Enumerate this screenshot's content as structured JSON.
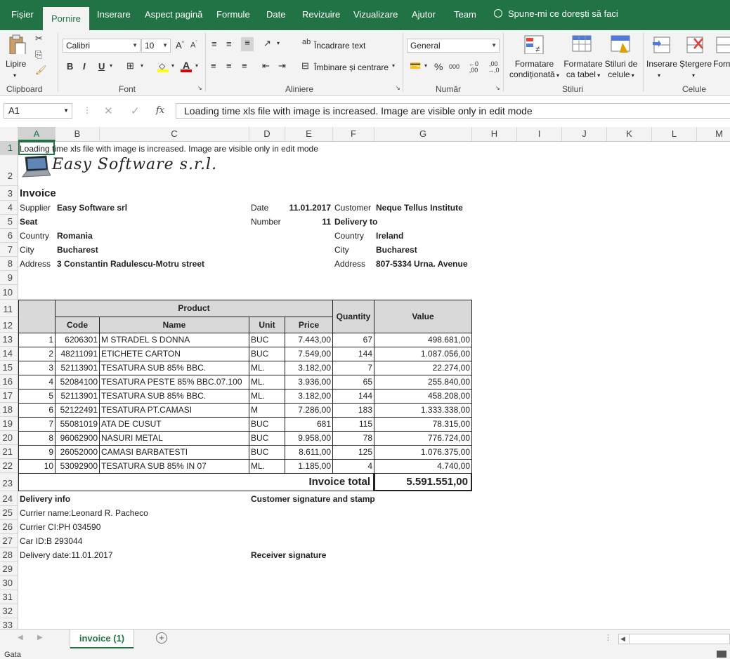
{
  "ribbon_tabs": [
    "Fișier",
    "Pornire",
    "Inserare",
    "Aspect pagină",
    "Formule",
    "Date",
    "Revizuire",
    "Vizualizare",
    "Ajutor",
    "Team"
  ],
  "tell_me": "Spune-mi ce dorești să faci",
  "clipboard": {
    "paste": "Lipire",
    "label": "Clipboard"
  },
  "font": {
    "name": "Calibri",
    "size": "10",
    "label": "Font",
    "bold": "B",
    "italic": "I",
    "underline": "U"
  },
  "alignment": {
    "wrap": "Încadrare text",
    "merge": "Îmbinare și centrare",
    "label": "Aliniere"
  },
  "number": {
    "format": "General",
    "label": "Număr",
    "percent": "%",
    "thousands": "000"
  },
  "styles": {
    "conditional": [
      "Formatare",
      "condiționată"
    ],
    "table": [
      "Formatare",
      "ca tabel"
    ],
    "cell": [
      "Stiluri de",
      "celule"
    ],
    "label": "Stiluri"
  },
  "cells": {
    "insert": "Inserare",
    "delete": "Ștergere",
    "format": "Form",
    "label": "Celule"
  },
  "formula_bar": {
    "name_box": "A1",
    "fx": "fx",
    "content": "Loading time xls file with image is increased. Image are visible only in edit mode"
  },
  "columns": [
    "A",
    "B",
    "C",
    "D",
    "E",
    "F",
    "G",
    "H",
    "I",
    "J",
    "K",
    "L",
    "M"
  ],
  "rows": [
    "1",
    "2",
    "3",
    "4",
    "5",
    "6",
    "7",
    "8",
    "9",
    "10",
    "11",
    "12",
    "13",
    "14",
    "15",
    "16",
    "17",
    "18",
    "19",
    "20",
    "21",
    "22",
    "23",
    "24",
    "25",
    "26",
    "27",
    "28",
    "29",
    "30",
    "31",
    "32",
    "33"
  ],
  "sheet": {
    "a1": "Loading time xls file with image is increased. Image are visible only in edit mode",
    "logo_text": "Easy Software s.r.l.",
    "title": "Invoice",
    "supplier_label": "Supplier",
    "supplier": "Easy Software srl",
    "seat": "Seat",
    "country_label": "Country",
    "country": "Romania",
    "city_label": "City",
    "city": "Bucharest",
    "address_label": "Address",
    "address": "3 Constantin Radulescu-Motru street",
    "date_label": "Date",
    "date": "11.01.2017",
    "number_label": "Number",
    "number": "11",
    "customer_label": "Customer",
    "customer": "Neque Tellus Institute",
    "delivery_to": "Delivery to",
    "cust_country_label": "Country",
    "cust_country": "Ireland",
    "cust_city_label": "City",
    "cust_city": "Bucharest",
    "cust_address_label": "Address",
    "cust_address": "807-5334 Urna. Avenue",
    "delivery_info": "Delivery info",
    "customer_signature": "Customer signature and stamp",
    "currier_name": "Currier name:Leonard R. Pacheco",
    "currier_ci": "Currier CI:PH 034590",
    "car_id": "Car ID:B 293044",
    "delivery_date": "Delivery date:11.01.2017",
    "receiver_signature": "Receiver signature"
  },
  "table": {
    "headers": {
      "product": "Product",
      "code": "Code",
      "name": "Name",
      "unit": "Unit",
      "price": "Price",
      "quantity": "Quantity",
      "value": "Value"
    },
    "rows": [
      {
        "no": "1",
        "code": "6206301",
        "name": "M STRADEL S DONNA",
        "unit": "BUC",
        "price": "7.443,00",
        "qty": "67",
        "value": "498.681,00"
      },
      {
        "no": "2",
        "code": "48211091",
        "name": "ETICHETE CARTON",
        "unit": "BUC",
        "price": "7.549,00",
        "qty": "144",
        "value": "1.087.056,00"
      },
      {
        "no": "3",
        "code": "52113901",
        "name": "TESATURA SUB 85% BBC.",
        "unit": "ML.",
        "price": "3.182,00",
        "qty": "7",
        "value": "22.274,00"
      },
      {
        "no": "4",
        "code": "52084100",
        "name": "TESATURA PESTE 85% BBC.07.100",
        "unit": "ML.",
        "price": "3.936,00",
        "qty": "65",
        "value": "255.840,00"
      },
      {
        "no": "5",
        "code": "52113901",
        "name": "TESATURA SUB 85% BBC.",
        "unit": "ML.",
        "price": "3.182,00",
        "qty": "144",
        "value": "458.208,00"
      },
      {
        "no": "6",
        "code": "52122491",
        "name": "TESATURA PT.CAMASI",
        "unit": "M",
        "price": "7.286,00",
        "qty": "183",
        "value": "1.333.338,00"
      },
      {
        "no": "7",
        "code": "55081019",
        "name": "ATA DE CUSUT",
        "unit": "BUC",
        "price": "681",
        "qty": "115",
        "value": "78.315,00"
      },
      {
        "no": "8",
        "code": "96062900",
        "name": "NASURI METAL",
        "unit": "BUC",
        "price": "9.958,00",
        "qty": "78",
        "value": "776.724,00"
      },
      {
        "no": "9",
        "code": "26052000",
        "name": "CAMASI BARBATESTI",
        "unit": "BUC",
        "price": "8.611,00",
        "qty": "125",
        "value": "1.076.375,00"
      },
      {
        "no": "10",
        "code": "53092900",
        "name": "TESATURA SUB 85% IN 07",
        "unit": "ML.",
        "price": "1.185,00",
        "qty": "4",
        "value": "4.740,00"
      }
    ],
    "total_label": "Invoice total",
    "total_value": "5.591.551,00"
  },
  "sheet_tab": "invoice (1)",
  "status": "Gata",
  "colors": {
    "excel_green": "#217346",
    "header_fill": "#d9d9d9"
  }
}
